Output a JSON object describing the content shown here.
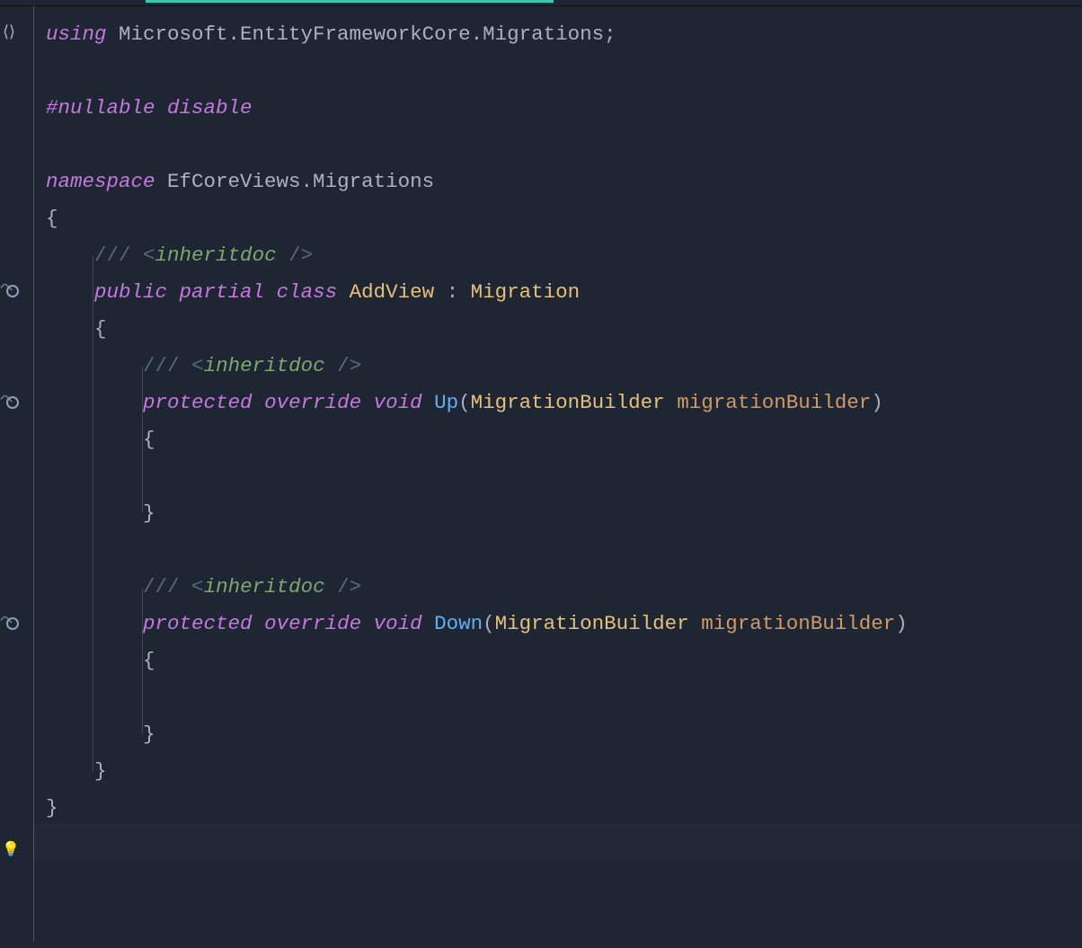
{
  "code": {
    "line1": {
      "using": "using",
      "ns": " Microsoft.EntityFrameworkCore.Migrations",
      "semi": ";"
    },
    "line3": {
      "preproc": "#nullable disable"
    },
    "line5": {
      "namespace": "namespace",
      "name": " EfCoreViews.Migrations"
    },
    "line6": {
      "brace": "{"
    },
    "line7": {
      "slashes": "/// ",
      "lt": "<",
      "tag": "inheritdoc",
      "slash": " /",
      "gt": ">"
    },
    "line8": {
      "public": "public",
      "partial": " partial",
      "class": " class",
      "name": " AddView",
      "colon": " : ",
      "base": "Migration"
    },
    "line9": {
      "brace": "{"
    },
    "line10": {
      "slashes": "/// ",
      "lt": "<",
      "tag": "inheritdoc",
      "slash": " /",
      "gt": ">"
    },
    "line11": {
      "protected": "protected",
      "override": " override",
      "void": " void",
      "method": " Up",
      "lparen": "(",
      "ptype": "MigrationBuilder",
      "pname": " migrationBuilder",
      "rparen": ")"
    },
    "line12": {
      "brace": "{"
    },
    "line14": {
      "brace": "}"
    },
    "line16": {
      "slashes": "/// ",
      "lt": "<",
      "tag": "inheritdoc",
      "slash": " /",
      "gt": ">"
    },
    "line17": {
      "protected": "protected",
      "override": " override",
      "void": " void",
      "method": " Down",
      "lparen": "(",
      "ptype": "MigrationBuilder",
      "pname": " migrationBuilder",
      "rparen": ")"
    },
    "line18": {
      "brace": "{"
    },
    "line20": {
      "brace": "}"
    },
    "line21": {
      "brace": "}"
    },
    "line22": {
      "brace": "}"
    }
  }
}
